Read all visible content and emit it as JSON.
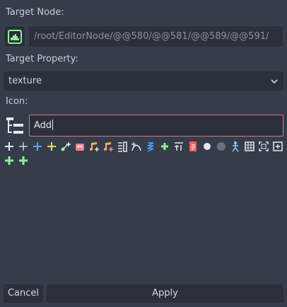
{
  "labels": {
    "target_node": "Target Node:",
    "target_property": "Target Property:",
    "icon": "Icon:"
  },
  "target_node": {
    "icon": "scene-node-icon",
    "path": "/root/EditorNode/@@580/@@581/@@589/@@591/"
  },
  "target_property": {
    "value": "texture",
    "icon": "chevron-down-icon"
  },
  "icon_search": {
    "icon": "tree-icon",
    "value": "Add"
  },
  "icon_results": [
    {
      "name": "add-white-icon"
    },
    {
      "name": "add-thin-icon"
    },
    {
      "name": "add-blue-icon"
    },
    {
      "name": "add-yellow-icon"
    },
    {
      "name": "add-node-connect-icon"
    },
    {
      "name": "add-animation-icon"
    },
    {
      "name": "add-audio-icon"
    },
    {
      "name": "add-audio-alt-icon"
    },
    {
      "name": "add-track-icon"
    },
    {
      "name": "add-curve-icon"
    },
    {
      "name": "add-spring-icon"
    },
    {
      "name": "add-green-icon"
    },
    {
      "name": "add-anchor-icon"
    },
    {
      "name": "add-script-icon"
    },
    {
      "name": "add-circle-white-icon"
    },
    {
      "name": "add-circle-dark-icon"
    },
    {
      "name": "add-bone-icon"
    },
    {
      "name": "add-grid-icon"
    },
    {
      "name": "add-frame-icon"
    },
    {
      "name": "add-square-icon"
    },
    {
      "name": "add-green-bold-icon"
    },
    {
      "name": "add-green-bold-alt-icon"
    }
  ],
  "buttons": {
    "cancel": "Cancel",
    "apply": "Apply"
  },
  "colors": {
    "background": "#363d4a",
    "field": "#2b303b",
    "focus_border": "#e2708a",
    "node_icon": "#8eef97"
  }
}
